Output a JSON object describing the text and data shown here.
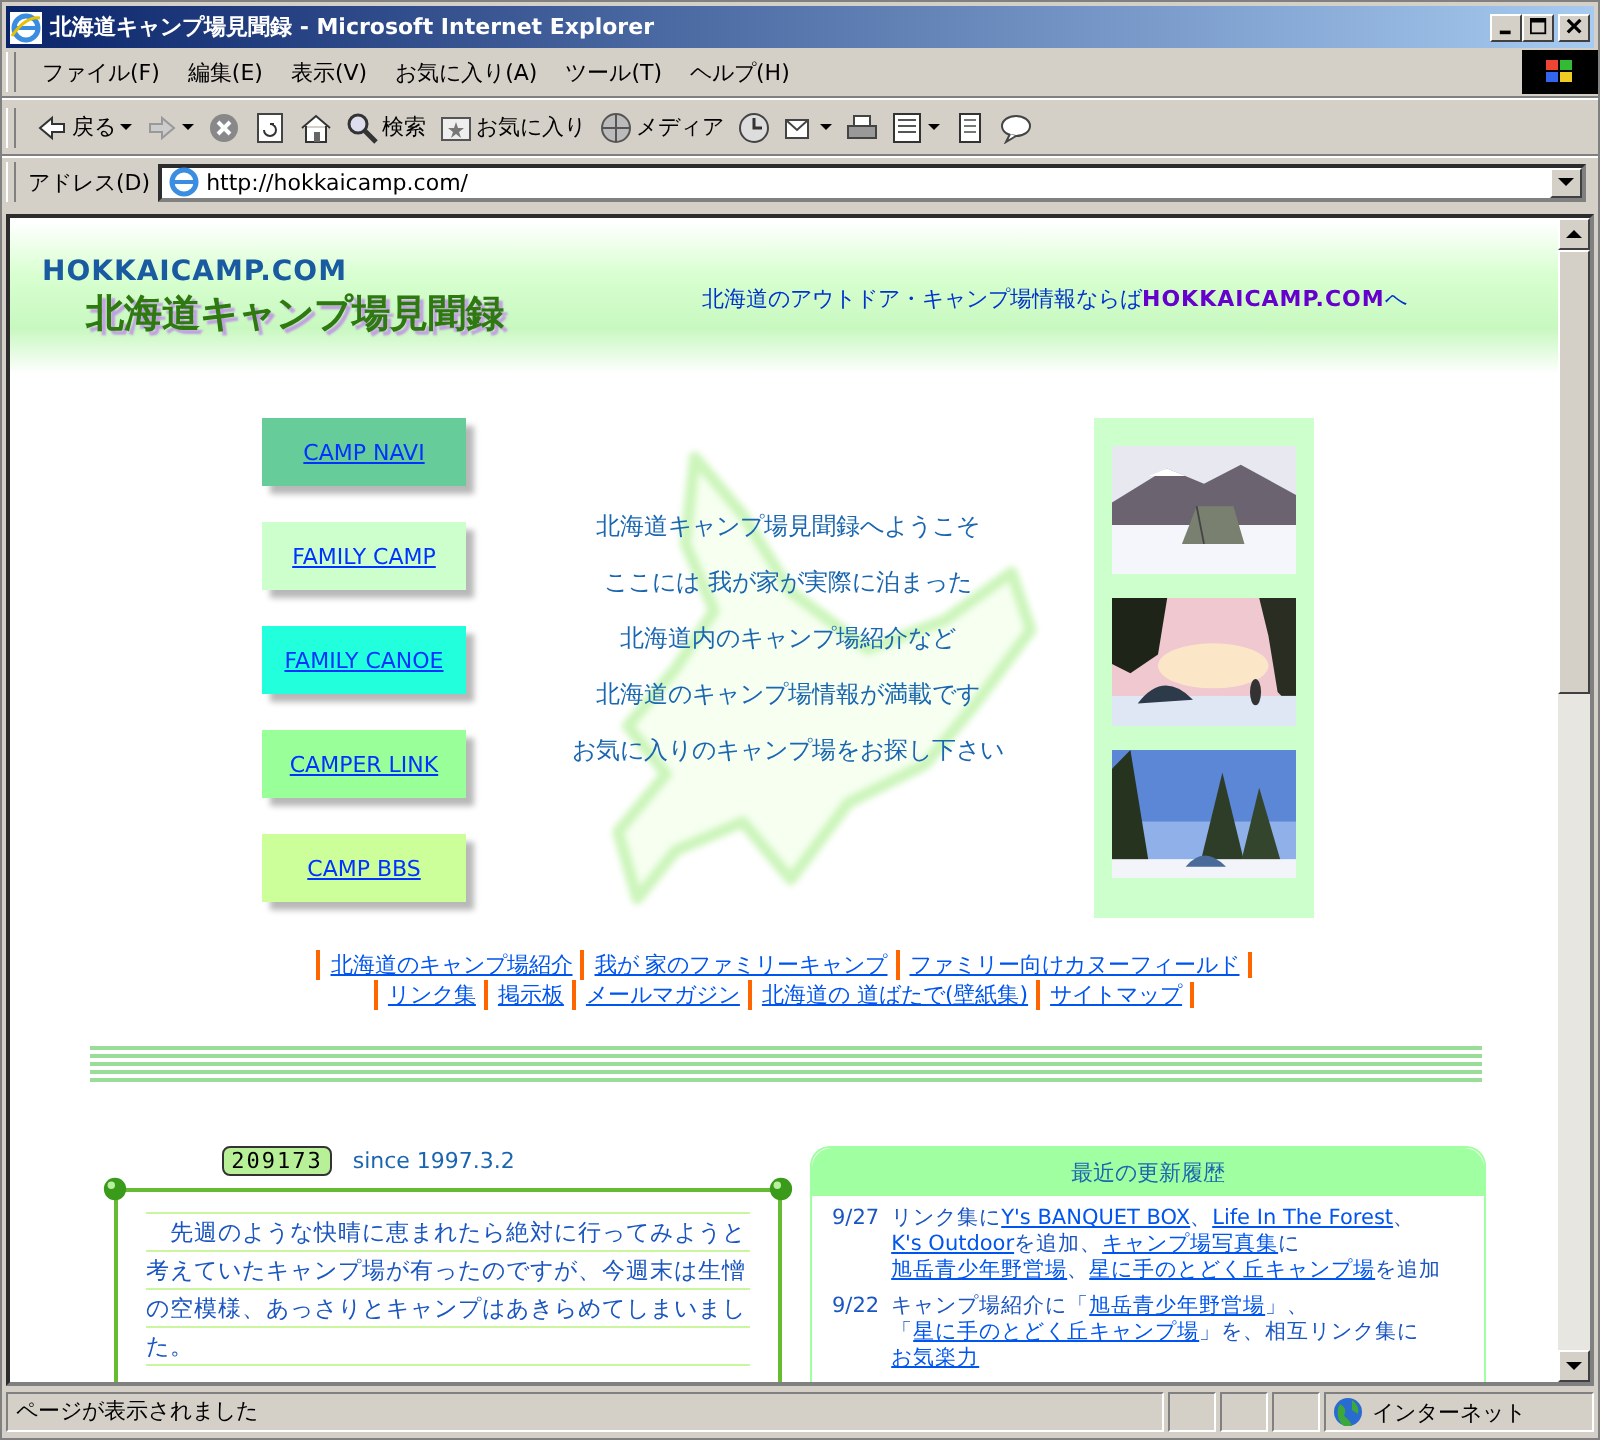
{
  "window": {
    "title": "北海道キャンプ場見聞録 - Microsoft Internet Explorer"
  },
  "menu": [
    "ファイル(F)",
    "編集(E)",
    "表示(V)",
    "お気に入り(A)",
    "ツール(T)",
    "ヘルプ(H)"
  ],
  "toolbar": [
    {
      "kind": "back",
      "label": "戻る",
      "dropdown": true
    },
    {
      "kind": "forward",
      "dropdown": true
    },
    {
      "kind": "stop"
    },
    {
      "kind": "refresh"
    },
    {
      "kind": "home"
    },
    {
      "kind": "search",
      "label": "検索"
    },
    {
      "kind": "favorites",
      "label": "お気に入り"
    },
    {
      "kind": "media",
      "label": "メディア"
    },
    {
      "kind": "history"
    },
    {
      "kind": "mail",
      "dropdown": true
    },
    {
      "kind": "print"
    },
    {
      "kind": "edit",
      "dropdown": true
    },
    {
      "kind": "discuss"
    },
    {
      "kind": "messenger"
    }
  ],
  "address": {
    "label": "アドレス(D)",
    "value": "http://hokkaicamp.com/"
  },
  "page": {
    "header": {
      "site": "HOKKAICAMP.COM",
      "title": "北海道キャンプ場見聞録",
      "tagline": "北海道のアウトドア・キャンプ場情報ならば",
      "tagline_link": "HOKKAICAMP.COM",
      "tagline_end": "へ"
    },
    "nav_buttons": [
      {
        "label": "CAMP NAVI",
        "color": "#66cc99"
      },
      {
        "label": "FAMILY CAMP",
        "color": "#ccffcc"
      },
      {
        "label": "FAMILY CANOE",
        "color": "#22ffdd"
      },
      {
        "label": "CAMPER LINK",
        "color": "#99ff99"
      },
      {
        "label": "CAMP BBS",
        "color": "#ccff99"
      }
    ],
    "welcome": [
      "北海道キャンプ場見聞録へようこそ",
      "ここには 我が家が実際に泊まった",
      "北海道内のキャンプ場紹介など",
      "北海道のキャンプ場情報が満載です",
      "お気に入りのキャンプ場をお探し下さい"
    ],
    "links": [
      [
        "北海道のキャンプ場紹介",
        "我が 家のファミリーキャンプ",
        "ファミリー向けカヌーフィールド"
      ],
      [
        "リンク集",
        "掲示板",
        "メールマガジン",
        "北海道の 道ばたで(壁紙集)",
        "サイトマップ"
      ]
    ],
    "counter": "209173",
    "since": "since 1997.3.2",
    "diary": "　先週のような快晴に恵まれたら絶対に行ってみようと考えていたキャンプ場が有ったのですが、今週末は生憎の空模様、あっさりとキャンプはあきらめてしまいました。",
    "updates": {
      "title": "最近の更新履歴",
      "items": [
        {
          "date": "9/27",
          "parts": [
            {
              "text": "リンク集に"
            },
            {
              "link": "Y's BANQUET BOX"
            },
            {
              "text": "、"
            },
            {
              "link": "Life In The Forest"
            },
            {
              "text": "、"
            },
            {
              "link": "K's Outdoor"
            },
            {
              "text": "を追加、"
            },
            {
              "link": "キャンプ場写真集"
            },
            {
              "text": "に"
            },
            {
              "link": "旭岳青少年野営場"
            },
            {
              "text": "、"
            },
            {
              "link": "星に手のとどく丘キャンプ場"
            },
            {
              "text": "を追加"
            }
          ]
        },
        {
          "date": "9/22",
          "parts": [
            {
              "text": "キャンプ場紹介に「"
            },
            {
              "link": "旭岳青少年野営場"
            },
            {
              "text": "」、「"
            },
            {
              "link": "星に手のとどく丘キャンプ場"
            },
            {
              "text": "」を、相互リンク集に"
            },
            {
              "link": "お気楽力"
            }
          ]
        }
      ]
    }
  },
  "status": {
    "text": "ページが表示されました",
    "zone": "インターネット"
  }
}
